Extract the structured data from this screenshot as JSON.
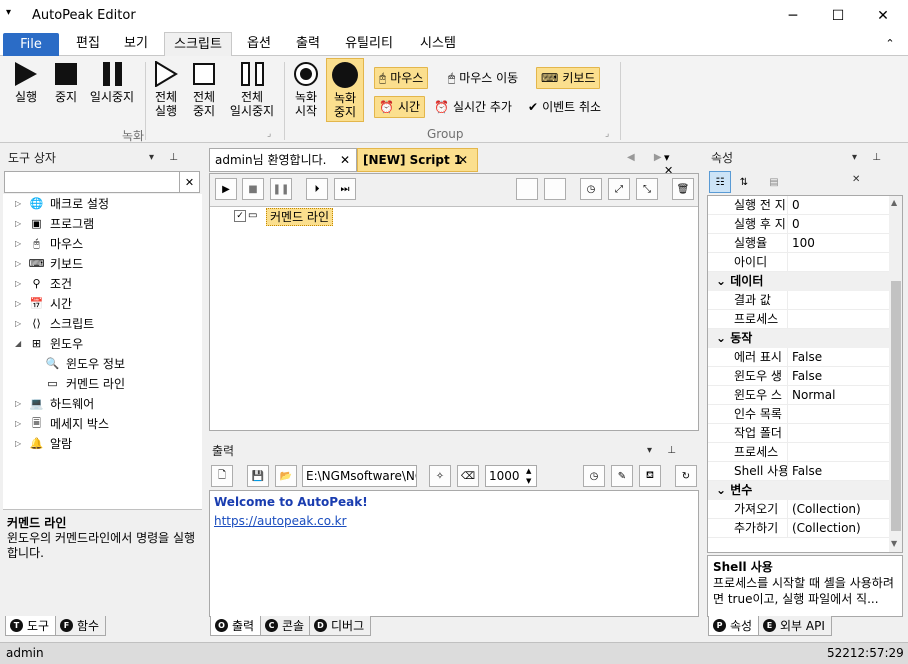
{
  "window": {
    "title": "AutoPeak Editor",
    "sys_menu_glyph": "▾",
    "min": "─",
    "max": "☐",
    "close": "✕"
  },
  "menu": {
    "tabs": [
      "File",
      "편집",
      "보기",
      "스크립트",
      "옵션",
      "출력",
      "유틸리티",
      "시스템"
    ],
    "collapse": "⌃"
  },
  "ribbon": {
    "record_group": "녹화",
    "group2": "Group",
    "run": "실행",
    "stop": "중지",
    "pause": "일시중지",
    "run_all": [
      "전체",
      "실행"
    ],
    "stop_all": [
      "전체",
      "중지"
    ],
    "pause_all": [
      "전체",
      "일시중지"
    ],
    "rec_start": [
      "녹화",
      "시작"
    ],
    "rec_stop": [
      "녹화",
      "중지"
    ],
    "mouse": "마우스",
    "mouse_move": "마우스 이동",
    "keyboard": "키보드",
    "time": "시간",
    "realtime_add": "실시간 추가",
    "event_cancel": "이벤트 취소"
  },
  "toolbox": {
    "title": "도구 상자",
    "clear_glyph": "✕",
    "items": [
      "매크로 설정",
      "프로그램",
      "마우스",
      "키보드",
      "조건",
      "시간",
      "스크립트",
      "윈도우",
      "윈도우 정보",
      "커멘드 라인",
      "하드웨어",
      "메세지 박스",
      "알람"
    ],
    "desc_title": "커멘드 라인",
    "desc_text": "윈도우의 커멘드라인에서 명령을 실행합니다.",
    "tab_tools": "도구",
    "tab_funcs": "함수"
  },
  "editor": {
    "tabs": [
      "admin님 환영합니다.",
      "[NEW] Script 1"
    ],
    "node_label": "커멘드 라인"
  },
  "output": {
    "title": "출력",
    "path": "E:\\NGMsoftware\\NG",
    "count": "1000",
    "lines": [
      "Welcome to AutoPeak!",
      "https://autopeak.co.kr"
    ],
    "tab_output": "출력",
    "tab_console": "콘솔",
    "tab_debug": "디버그"
  },
  "props": {
    "title": "속성",
    "rows_top": [
      [
        "실행 전 지",
        "0"
      ],
      [
        "실행 후 지",
        "0"
      ],
      [
        "실행율",
        "100"
      ],
      [
        "아이디",
        ""
      ]
    ],
    "cat_data": "데이터",
    "rows_data": [
      [
        "결과 값",
        ""
      ],
      [
        "프로세스",
        ""
      ]
    ],
    "cat_action": "동작",
    "rows_action": [
      [
        "에러 표시",
        "False"
      ],
      [
        "윈도우 생",
        "False"
      ],
      [
        "윈도우 스",
        "Normal"
      ],
      [
        "인수 목록",
        ""
      ],
      [
        "작업 폴더",
        ""
      ],
      [
        "프로세스",
        ""
      ],
      [
        "Shell 사용",
        "False"
      ]
    ],
    "cat_var": "변수",
    "rows_var": [
      [
        "가져오기",
        "(Collection)"
      ],
      [
        "추가하기",
        "(Collection)"
      ]
    ],
    "desc_title": "Shell 사용",
    "desc_text": "프로세스를 시작할 때 셸을 사용하려면 true이고, 실행 파일에서 직...",
    "tab_props": "속성",
    "tab_api": "외부 API"
  },
  "status": {
    "user": "admin",
    "time": "52212:57:29"
  },
  "colors": {
    "accent": "#2b6cc6",
    "highlight": "#fbdf8e",
    "link": "#1a4dbf"
  }
}
